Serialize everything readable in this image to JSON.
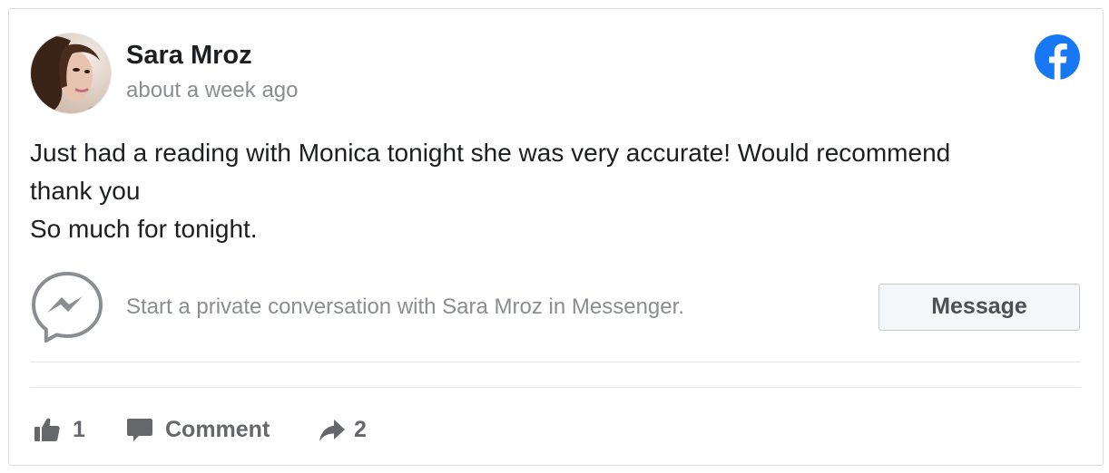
{
  "post": {
    "author": "Sara Mroz",
    "timestamp": "about a week ago",
    "body_lines": [
      "Just had a reading with Monica tonight she was very accurate! Would recommend",
      "thank you",
      "So much for tonight."
    ]
  },
  "messenger": {
    "icon": "messenger-icon",
    "prompt": "Start a private conversation with Sara Mroz in Messenger.",
    "button_label": "Message"
  },
  "actions": {
    "likes": "1",
    "comment_label": "Comment",
    "shares": "2"
  },
  "icons": {
    "brand": "facebook-logo-icon",
    "like": "thumbs-up-icon",
    "comment": "comment-bubble-icon",
    "share": "share-arrow-icon"
  },
  "colors": {
    "facebook_blue": "#1877f2",
    "text_primary": "#1c1e21",
    "text_secondary": "#8a8d91",
    "action_gray": "#65676b",
    "divider": "#e4e6eb",
    "button_bg": "#f5f6f7"
  }
}
